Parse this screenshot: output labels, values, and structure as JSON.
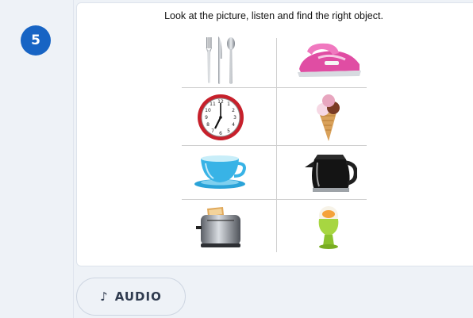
{
  "question": {
    "number": "5",
    "instruction": "Look at the picture, listen and find the right object."
  },
  "objects": [
    {
      "icon": "cutlery-icon"
    },
    {
      "icon": "iron-icon"
    },
    {
      "icon": "clock-icon"
    },
    {
      "icon": "ice-cream-icon"
    },
    {
      "icon": "teacup-icon"
    },
    {
      "icon": "coffee-pot-icon"
    },
    {
      "icon": "toaster-icon"
    },
    {
      "icon": "boiled-egg-icon"
    }
  ],
  "audio": {
    "icon": "music-note-icon",
    "glyph": "♪",
    "label": "AUDIO"
  },
  "colors": {
    "badge": "#1764c4",
    "card_border": "#dde3ec",
    "background": "#eef2f7"
  }
}
